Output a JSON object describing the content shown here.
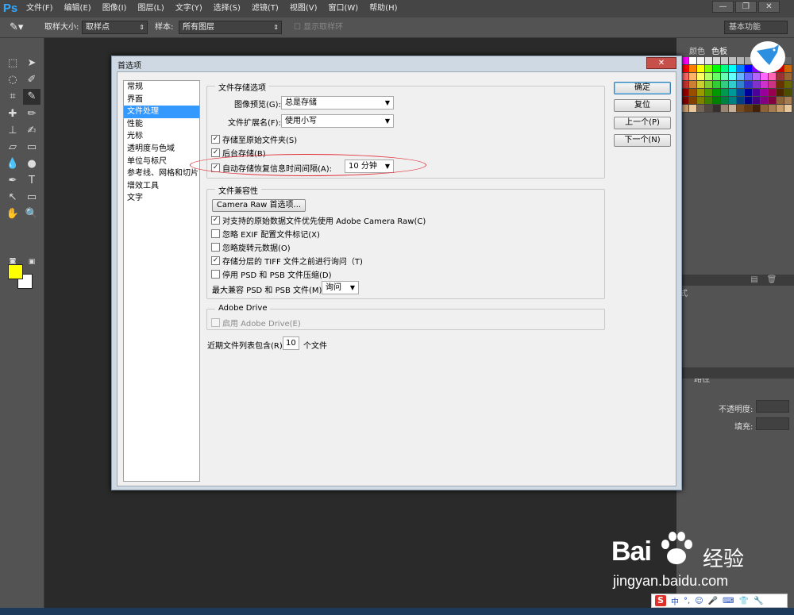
{
  "app": {
    "logo": "Ps"
  },
  "menu": [
    "文件(F)",
    "编辑(E)",
    "图像(I)",
    "图层(L)",
    "文字(Y)",
    "选择(S)",
    "滤镜(T)",
    "视图(V)",
    "窗口(W)",
    "帮助(H)"
  ],
  "window_controls": {
    "minimize": "—",
    "restore": "❐",
    "close": "✕"
  },
  "options_bar": {
    "sample_size_label": "取样大小:",
    "sample_size_value": "取样点",
    "sample_label": "样本:",
    "sample_value": "所有图层",
    "show_ring_label": "显示取样环",
    "workspace": "基本功能"
  },
  "panel_tabs": {
    "color": "颜色",
    "swatches": "色板",
    "paths": "路径",
    "styles": "式"
  },
  "layers_panel": {
    "opacity_label": "不透明度:",
    "fill_label": "填充:"
  },
  "dialog": {
    "title": "首选项",
    "close": "✕",
    "categories": [
      "常规",
      "界面",
      "文件处理",
      "性能",
      "光标",
      "透明度与色域",
      "单位与标尺",
      "参考线、网格和切片",
      "增效工具",
      "文字"
    ],
    "selected_category": "文件处理",
    "save_group": {
      "title": "文件存储选项",
      "preview_label": "图像预览(G):",
      "preview_value": "总是存储",
      "ext_label": "文件扩展名(F):",
      "ext_value": "使用小写",
      "save_orig_folder": "存储至原始文件夹(S)",
      "bg_save": "后台存储(B)",
      "autosave_label": "自动存储恢复信息时间间隔(A):",
      "autosave_value": "10 分钟"
    },
    "compat_group": {
      "title": "文件兼容性",
      "camera_raw_btn": "Camera Raw 首选项...",
      "prefer_acr": "对支持的原始数据文件优先使用 Adobe Camera Raw(C)",
      "ignore_exif": "忽略 EXIF 配置文件标记(X)",
      "ignore_rotate": "忽略旋转元数据(O)",
      "ask_tiff": "存储分层的 TIFF 文件之前进行询问（T)",
      "disable_compress": "停用 PSD 和 PSB 文件压缩(D)",
      "max_compat_label": "最大兼容 PSD 和 PSB 文件(M):",
      "max_compat_value": "询问"
    },
    "drive_group": {
      "title": "Adobe Drive",
      "enable": "启用 Adobe Drive(E)"
    },
    "recent_label": "近期文件列表包含(R):",
    "recent_value": "10",
    "recent_suffix": "个文件",
    "buttons": {
      "ok": "确定",
      "reset": "复位",
      "prev": "上一个(P)",
      "next": "下一个(N)"
    },
    "checked": {
      "save_orig_folder": true,
      "bg_save": true,
      "autosave": true,
      "prefer_acr": true,
      "ignore_exif": false,
      "ignore_rotate": false,
      "ask_tiff": true,
      "disable_compress": false,
      "enable_drive": false
    }
  },
  "watermark": {
    "brand": "Bai",
    "brand_cn": "经验",
    "url": "jingyan.baidu.com"
  },
  "ime": {
    "s_logo": "S",
    "items": [
      "中",
      "°,",
      "☺",
      "🎤",
      "⌨",
      "👕",
      "🔧"
    ]
  },
  "colors": {
    "foreground": "#ffff00",
    "background": "#ffffff",
    "selection": "#3399ff",
    "highlight_ellipse": "#e0303a"
  }
}
